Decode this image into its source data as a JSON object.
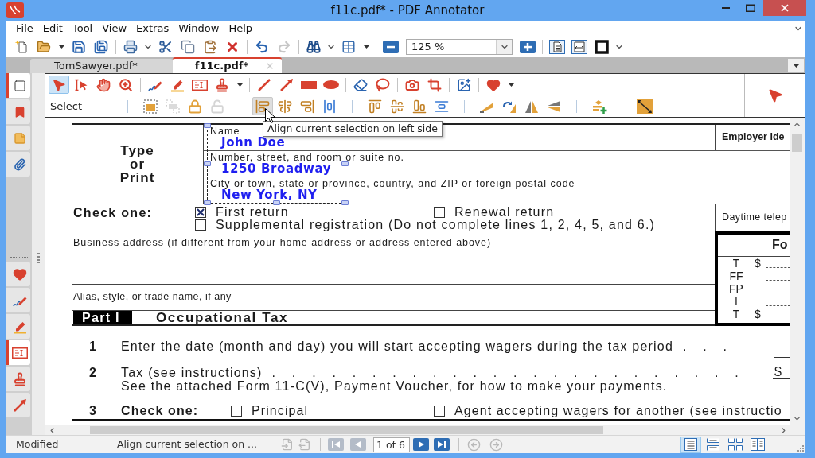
{
  "window": {
    "title": "f11c.pdf* - PDF Annotator"
  },
  "menu": [
    "File",
    "Edit",
    "Tool",
    "View",
    "Extras",
    "Window",
    "Help"
  ],
  "toolbar": {
    "buttons": [
      {
        "disabled": false
      },
      {
        "disabled": false
      },
      {
        "disabled": false
      },
      {
        "disabled": false
      },
      {
        "disabled": false
      },
      {
        "disabled": false
      },
      {
        "disabled": false
      },
      {
        "disabled": false
      },
      {
        "disabled": false
      },
      {
        "disabled": false
      },
      {
        "disabled": true
      },
      {
        "disabled": false
      },
      {
        "disabled": false
      },
      {
        "disabled": false
      },
      {
        "disabled": false
      },
      {
        "disabled": false
      },
      {
        "disabled": false
      },
      {
        "disabled": false
      }
    ],
    "zoom": {
      "value": "125 %"
    }
  },
  "tabs": [
    {
      "label": "TomSawyer.pdf*",
      "selected": false
    },
    {
      "label": "f11c.pdf*",
      "selected": true
    }
  ],
  "sidebar": {
    "panel_tabs": [
      {
        "selected": true
      },
      {
        "selected": false
      },
      {
        "selected": false
      },
      {
        "selected": false
      }
    ],
    "tool_tabs": [
      {
        "selected": false
      },
      {
        "selected": false
      },
      {
        "selected": false
      },
      {
        "selected": true
      },
      {
        "selected": false
      },
      {
        "selected": false
      }
    ]
  },
  "ribbon": {
    "tools": [
      {
        "selected": true
      },
      {
        "selected": false
      },
      {
        "selected": false
      },
      {
        "selected": false
      },
      {
        "selected": false
      },
      {
        "selected": false
      },
      {
        "selected": false
      },
      {
        "selected": false
      },
      {
        "selected": false
      },
      {
        "selected": false
      },
      {
        "selected": false
      },
      {
        "selected": false
      },
      {
        "selected": false
      },
      {
        "selected": false
      },
      {
        "selected": false
      },
      {
        "selected": false
      },
      {
        "selected": false
      },
      {
        "selected": false
      }
    ],
    "mode_label": "Select",
    "arrange_tools": [
      {
        "disabled": false,
        "highlighted": false
      },
      {
        "disabled": true,
        "highlighted": false
      },
      {
        "disabled": false,
        "highlighted": false
      },
      {
        "disabled": true,
        "highlighted": false
      },
      {
        "disabled": false,
        "highlighted": true
      },
      {
        "disabled": false,
        "highlighted": false
      },
      {
        "disabled": false,
        "highlighted": false
      },
      {
        "disabled": false,
        "highlighted": false
      },
      {
        "disabled": false,
        "highlighted": false
      },
      {
        "disabled": false,
        "highlighted": false
      },
      {
        "disabled": false,
        "highlighted": false
      },
      {
        "disabled": false,
        "highlighted": false
      },
      {
        "disabled": false,
        "highlighted": false
      },
      {
        "disabled": false,
        "highlighted": false
      },
      {
        "disabled": false,
        "highlighted": false
      },
      {
        "disabled": false,
        "highlighted": false
      },
      {
        "disabled": false,
        "highlighted": false
      },
      {
        "disabled": false,
        "highlighted": false
      }
    ]
  },
  "tooltip": {
    "text": "Align current selection on left side"
  },
  "document": {
    "type_or_print": "Type or Print",
    "fields": [
      {
        "label": "Name",
        "value": "John Doe"
      },
      {
        "label": "Number, street, and room or suite no.",
        "value": "1250 Broadway"
      },
      {
        "label": "City or town, state or province, country, and ZIP or foreign postal code",
        "value": "New York, NY"
      }
    ],
    "employer_label": "Employer ide",
    "check_one": {
      "label": "Check one:",
      "options": [
        {
          "label": "First return",
          "checked": true
        },
        {
          "label": "Renewal return",
          "checked": false
        },
        {
          "label": "Supplemental registration (Do not complete lines 1, 2, 4, 5, and 6.)",
          "checked": false
        }
      ]
    },
    "phone_label": "Daytime telep",
    "business_address_label": "Business address (if different from your home address or address entered above)",
    "alias_label": "Alias, style, or trade name, if any",
    "office_box": {
      "title": "Fo",
      "rows": [
        {
          "code": "T",
          "sign": "$"
        },
        {
          "code": "FF"
        },
        {
          "code": "FP"
        },
        {
          "code": "I"
        },
        {
          "code": "T",
          "sign": "$"
        }
      ]
    },
    "part": {
      "badge": "Part I",
      "title": "Occupational Tax"
    },
    "line_1": {
      "number": "1",
      "text": "Enter the date (month and day) you will start accepting wagers during the tax period",
      "leader": ". . ."
    },
    "line_2": {
      "number": "2",
      "text": "Tax (see instructions)",
      "leader": ". . . . . . . . . . . . . . . . . . . . . . . .",
      "sign": "$",
      "note": "See the attached Form 11-C(V), Payment Voucher, for how to make your payments."
    },
    "line_3": {
      "number": "3",
      "label": "Check one:",
      "options": [
        {
          "label": "Principal",
          "checked": false
        },
        {
          "label": "Agent accepting wagers for another (see instructio",
          "checked": false
        }
      ]
    }
  },
  "status_bar": {
    "state": "Modified",
    "hint": "Align current selection on ...",
    "document_nav": [
      {
        "disabled": true
      },
      {
        "disabled": true
      }
    ],
    "page_nav": [
      {
        "disabled": true
      },
      {
        "disabled": true
      },
      {
        "disabled": false
      },
      {
        "disabled": false
      }
    ],
    "page_field": {
      "value": "1 of 6"
    },
    "history_nav": [
      {
        "disabled": true
      },
      {
        "disabled": true
      }
    ],
    "view_modes": [
      {
        "selected": true
      },
      {
        "selected": false
      },
      {
        "selected": false
      },
      {
        "selected": false
      }
    ]
  }
}
